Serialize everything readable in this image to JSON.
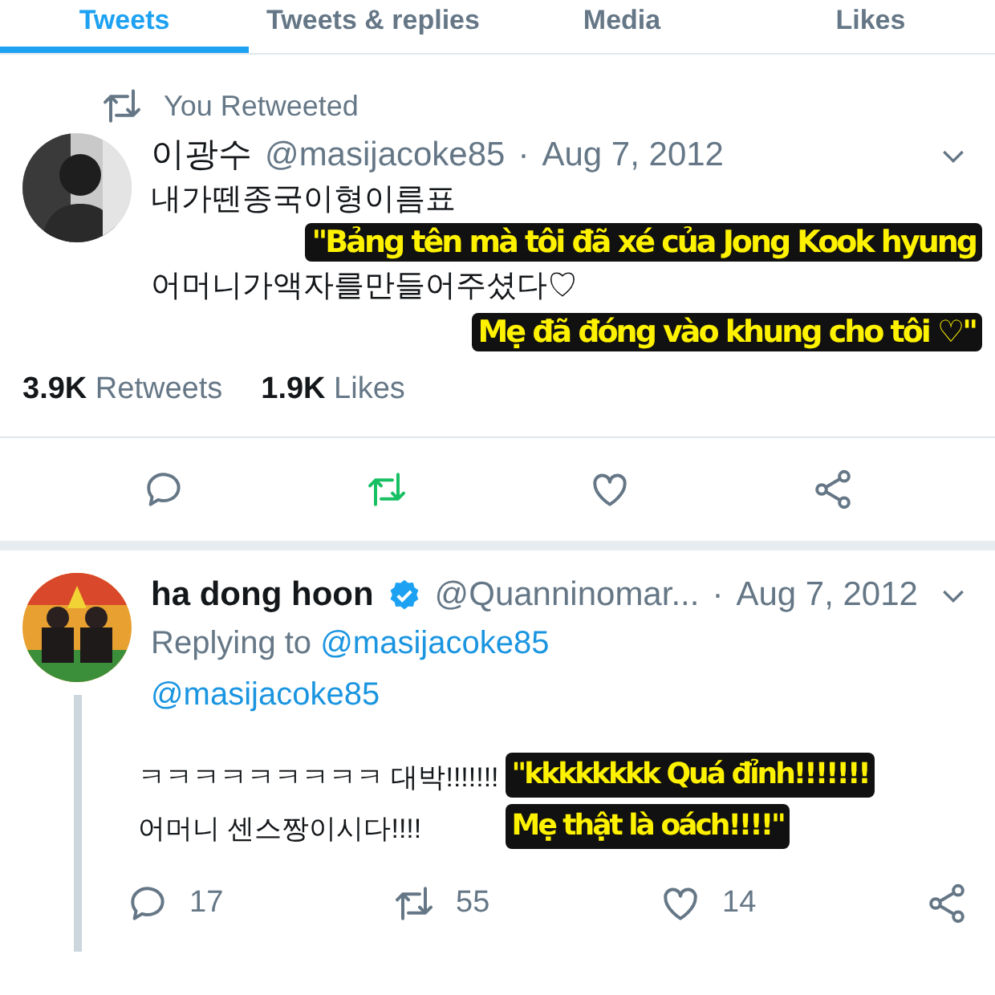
{
  "tabs": [
    {
      "label": "Tweets",
      "selected": true
    },
    {
      "label": "Tweets & replies",
      "selected": false
    },
    {
      "label": "Media",
      "selected": false
    },
    {
      "label": "Likes",
      "selected": false
    }
  ],
  "retweet_notice": "You Retweeted",
  "tweet": {
    "name": "이광수",
    "handle": "@masijacoke85",
    "separator": "·",
    "date": "Aug 7, 2012",
    "lines": [
      "내가뗀종국이형이름표",
      "어머니가액자를만들어주셨다♡"
    ],
    "captions": [
      "\"Bảng tên mà tôi đã xé của Jong Kook hyung",
      "Mẹ đã đóng vào khung cho tôi ♡\""
    ],
    "stats": [
      {
        "count": "3.9K",
        "label": "Retweets"
      },
      {
        "count": "1.9K",
        "label": "Likes"
      }
    ],
    "actions": [
      {
        "kind": "reply",
        "active": false
      },
      {
        "kind": "retweet",
        "active": true
      },
      {
        "kind": "like",
        "active": false
      },
      {
        "kind": "share",
        "active": false
      }
    ]
  },
  "reply": {
    "name": "ha dong hoon",
    "verified": true,
    "handle": "@Quanninomar...",
    "separator": "·",
    "date": "Aug 7, 2012",
    "replying_label": "Replying to",
    "replying_handle": "@masijacoke85",
    "mention": "@masijacoke85",
    "lines": [
      "ㅋㅋㅋㅋㅋㅋㅋㅋㅋ 대박!!!!!!!",
      "어머니 센스짱이시다!!!!"
    ],
    "captions": [
      "\"kkkkkkkk Quá đỉnh!!!!!!!",
      "Mẹ thật là oách!!!!\""
    ],
    "actions": [
      {
        "kind": "reply",
        "active": false,
        "count": "17"
      },
      {
        "kind": "retweet",
        "active": false,
        "count": "55"
      },
      {
        "kind": "like",
        "active": false,
        "count": "14"
      },
      {
        "kind": "share",
        "active": false
      }
    ]
  }
}
